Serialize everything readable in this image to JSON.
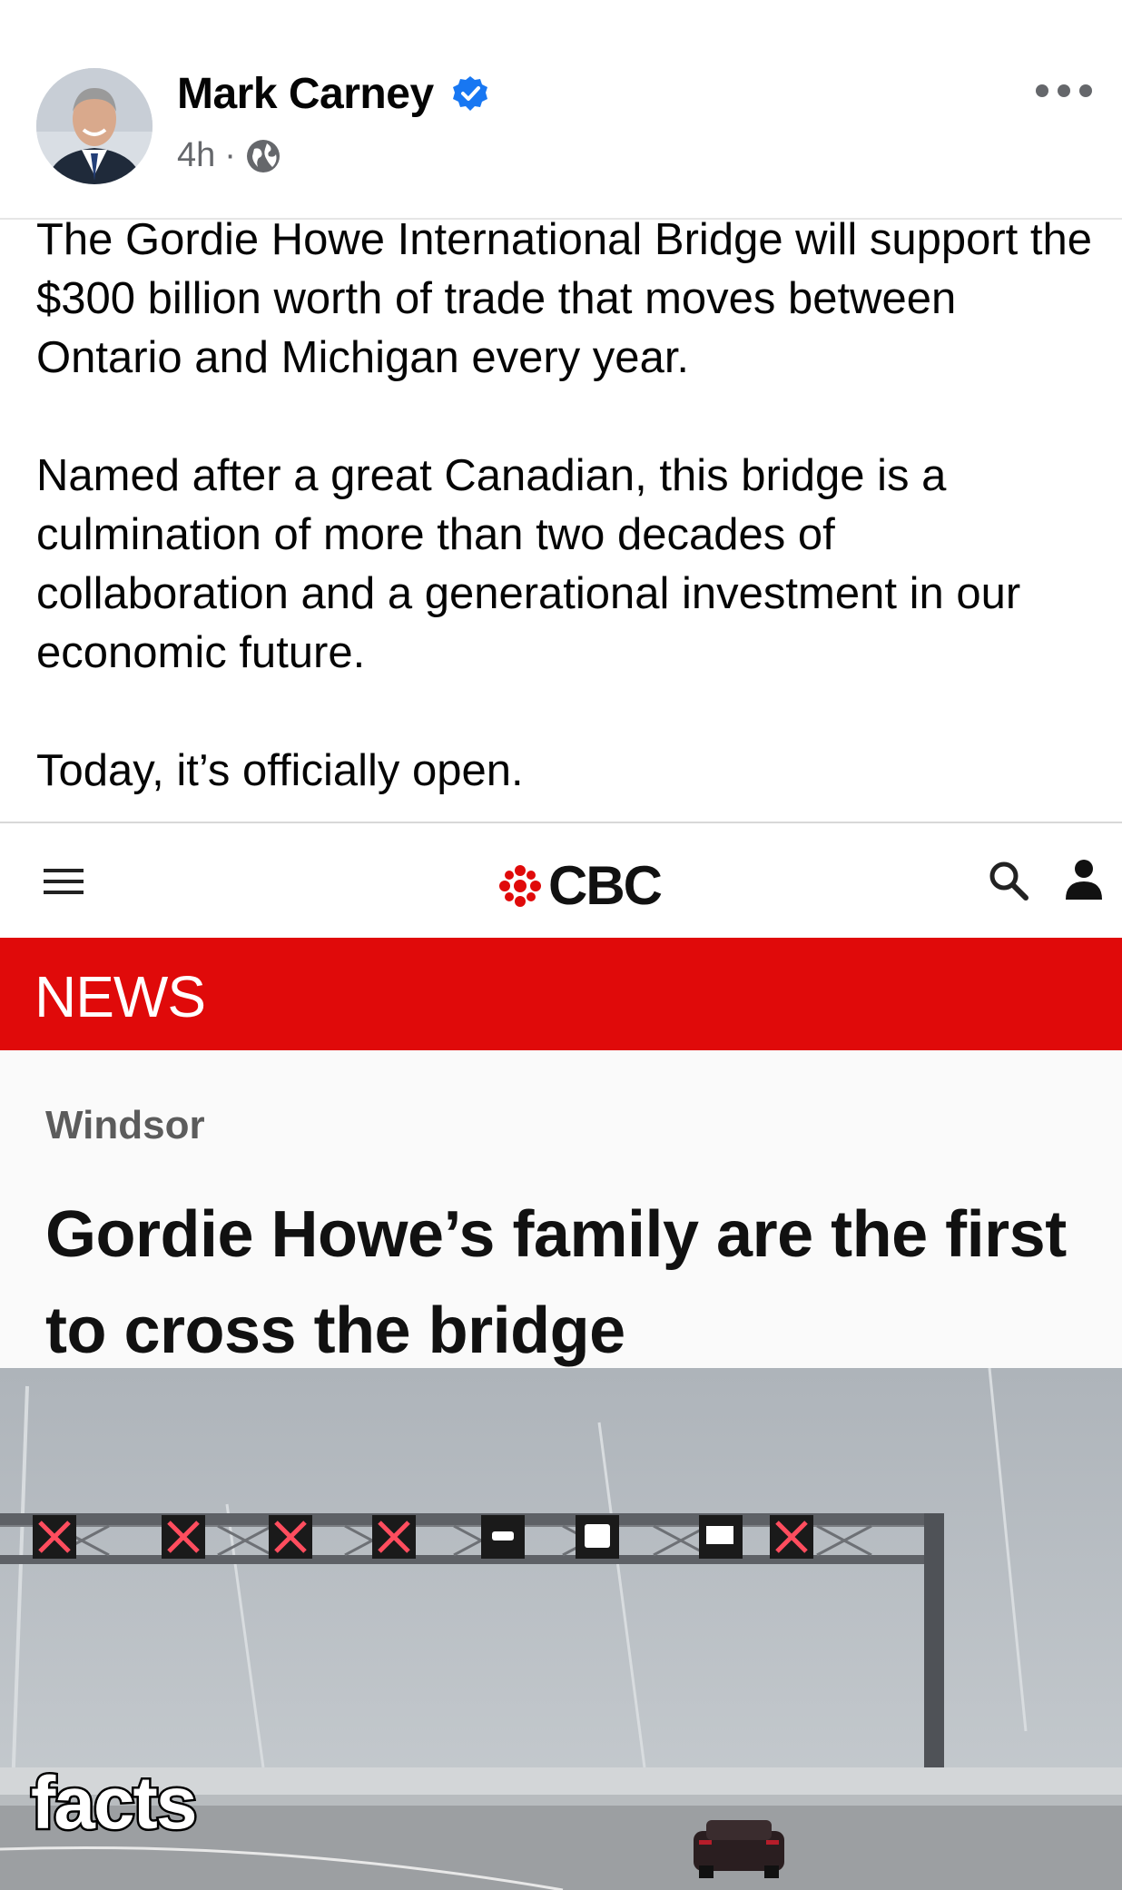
{
  "post": {
    "author": "Mark Carney",
    "time": "4h",
    "separator": "·",
    "paragraphs": [
      "The Gordie Howe International Bridge will support the $300 billion worth of trade that moves between Ontario and Michigan every year.",
      "Named after a great Canadian, this bridge is a culmination of more than two decades of collaboration and a generational investment in our economic future.",
      "Today, it’s officially open."
    ]
  },
  "article": {
    "brand": "CBC",
    "section_bar": "NEWS",
    "section": "Windsor",
    "headline": "Gordie Howe’s family are the first to cross the bridge",
    "brand_color": "#e00a0a"
  },
  "overlay": {
    "caption": "facts"
  },
  "icons": {
    "verified": "verified-badge-icon",
    "audience": "globe-icon",
    "more": "more-options-icon",
    "menu": "hamburger-menu-icon",
    "search": "search-icon",
    "account": "user-icon"
  }
}
